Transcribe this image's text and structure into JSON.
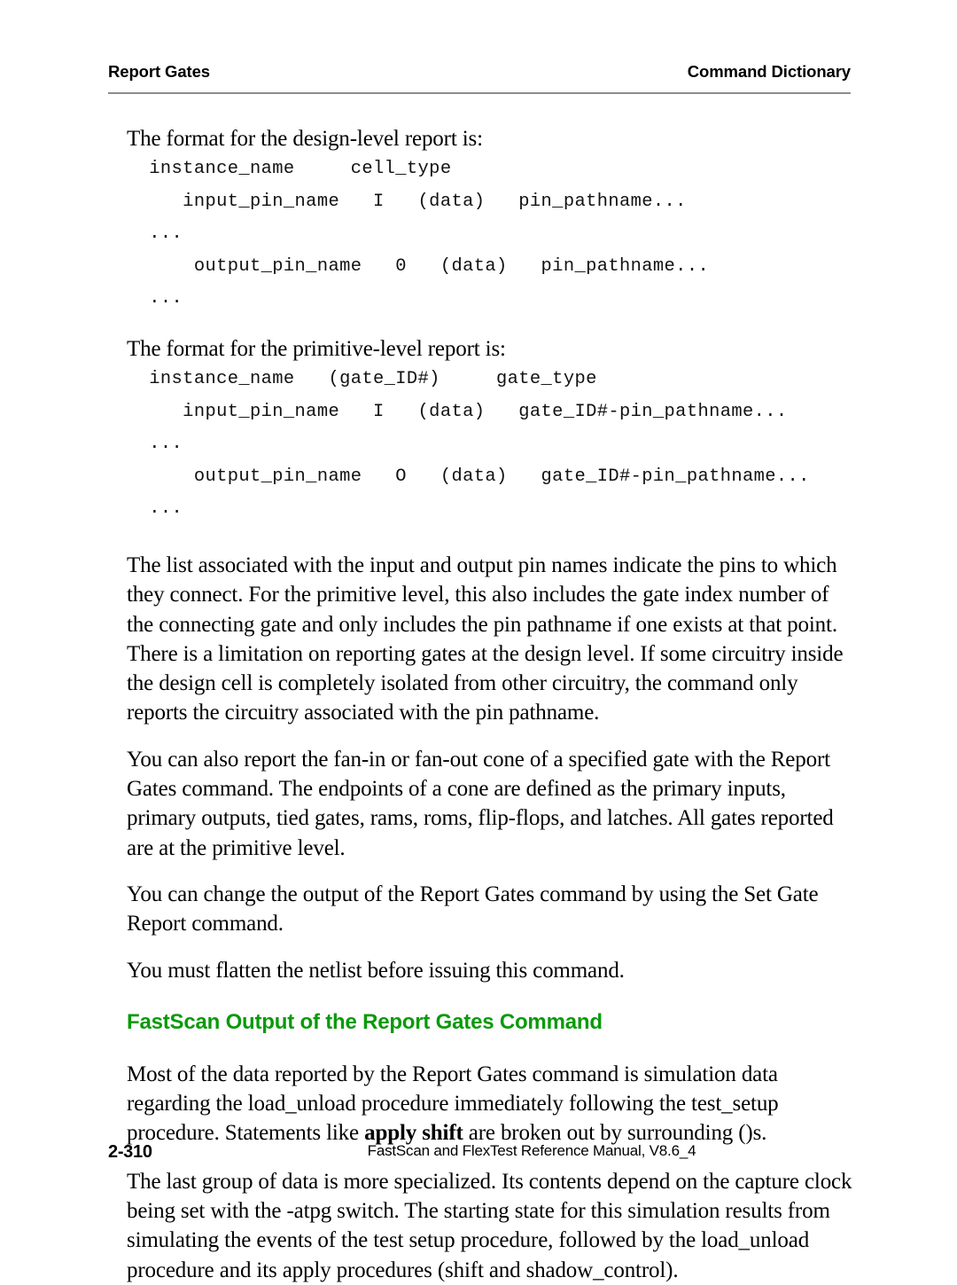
{
  "header": {
    "left_title": "Report Gates",
    "right_title": "Command Dictionary"
  },
  "content": {
    "lead_in_design": "The format for the design-level report is:",
    "code_design": "  instance_name     cell_type\n     input_pin_name   I   (data)   pin_pathname...\n  ...\n      output_pin_name   0   (data)   pin_pathname...\n  ...",
    "lead_in_primitive": "The format for the primitive-level report is:",
    "code_primitive": "  instance_name   (gate_ID#)     gate_type\n     input_pin_name   I   (data)   gate_ID#-pin_pathname...\n  ...\n      output_pin_name   O   (data)   gate_ID#-pin_pathname...\n  ...",
    "para_pin_list": "The list associated with the input and output pin names indicate the pins to which they connect. For the primitive level, this also includes the gate index number of the connecting gate and only includes the pin pathname if one exists at that point. There is a limitation on reporting gates at the design level. If some circuitry inside the design cell is completely isolated from other circuitry, the command only reports the circuitry associated with the pin pathname.",
    "para_cone": "You can also report the fan-in or fan-out cone of a specified gate with the Report Gates command. The endpoints of a cone are defined as the primary inputs, primary outputs, tied gates, rams, roms, flip-flops, and latches. All gates reported are at the primitive level.",
    "para_set_gate_report": "You can change the output of the Report Gates command by using the Set Gate Report command.",
    "para_flatten": "You must flatten the netlist before issuing this command.",
    "section_heading": "FastScan Output of the Report Gates Command",
    "para_simulation_1": "Most of the data reported by the Report Gates command is simulation data regarding the load_unload procedure immediately following the test_setup procedure. Statements like ",
    "para_simulation_bold": "apply shift",
    "para_simulation_2": " are broken out by surrounding ()s.",
    "para_last_group": "The last group of data is more specialized. Its contents depend on the capture clock being set with the -atpg switch. The starting state for this simulation results from simulating the events of the test setup procedure, followed by the load_unload procedure and its apply procedures (shift and shadow_control)."
  },
  "footer": {
    "page_number": "2-310",
    "manual_reference": "FastScan and FlexTest Reference Manual, V8.6_4"
  },
  "colors": {
    "heading_green": "#0a9a0a",
    "rule_gray": "#8c8c8c",
    "text_black": "#000000"
  }
}
